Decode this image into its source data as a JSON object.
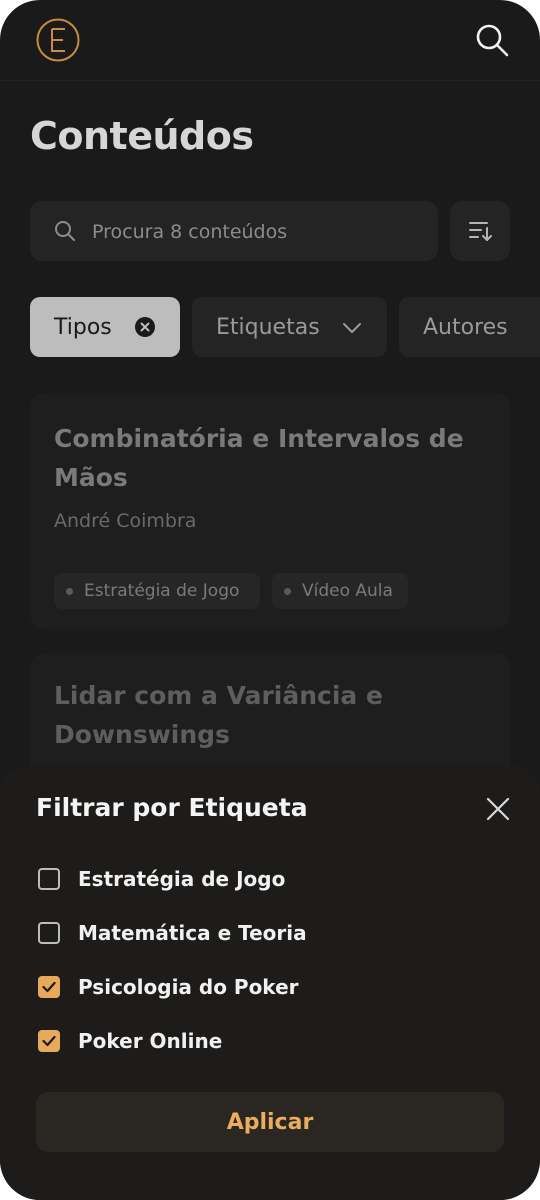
{
  "header": {
    "logo_icon": "circle-e-logo",
    "search_icon": "search-icon"
  },
  "page": {
    "title": "Conteúdos"
  },
  "search": {
    "placeholder": "Procura 8 conteúdos",
    "value": ""
  },
  "sort": {
    "icon": "sort-descending-icon"
  },
  "filters": [
    {
      "label": "Tipos",
      "active": true,
      "icon": "clear-circle-icon"
    },
    {
      "label": "Etiquetas",
      "active": false,
      "icon": "chevron-down-icon"
    },
    {
      "label": "Autores",
      "active": false,
      "icon": "chevron-down-icon"
    }
  ],
  "cards": [
    {
      "title": "Combinatória e Intervalos de Mãos",
      "author": "André Coimbra",
      "tags": [
        "Estratégia de Jogo",
        "Vídeo Aula"
      ]
    },
    {
      "title": "Lidar com a Variância e Downswings"
    }
  ],
  "sheet": {
    "title": "Filtrar por Etiqueta",
    "options": [
      {
        "label": "Estratégia de Jogo",
        "checked": false
      },
      {
        "label": "Matemática e Teoria",
        "checked": false
      },
      {
        "label": "Psicologia do Poker",
        "checked": true
      },
      {
        "label": "Poker Online",
        "checked": true
      }
    ],
    "apply_label": "Aplicar"
  },
  "colors": {
    "background": "#1a1a1a",
    "accent": "#e7a95a",
    "active_chip": "#bdbdbd"
  }
}
